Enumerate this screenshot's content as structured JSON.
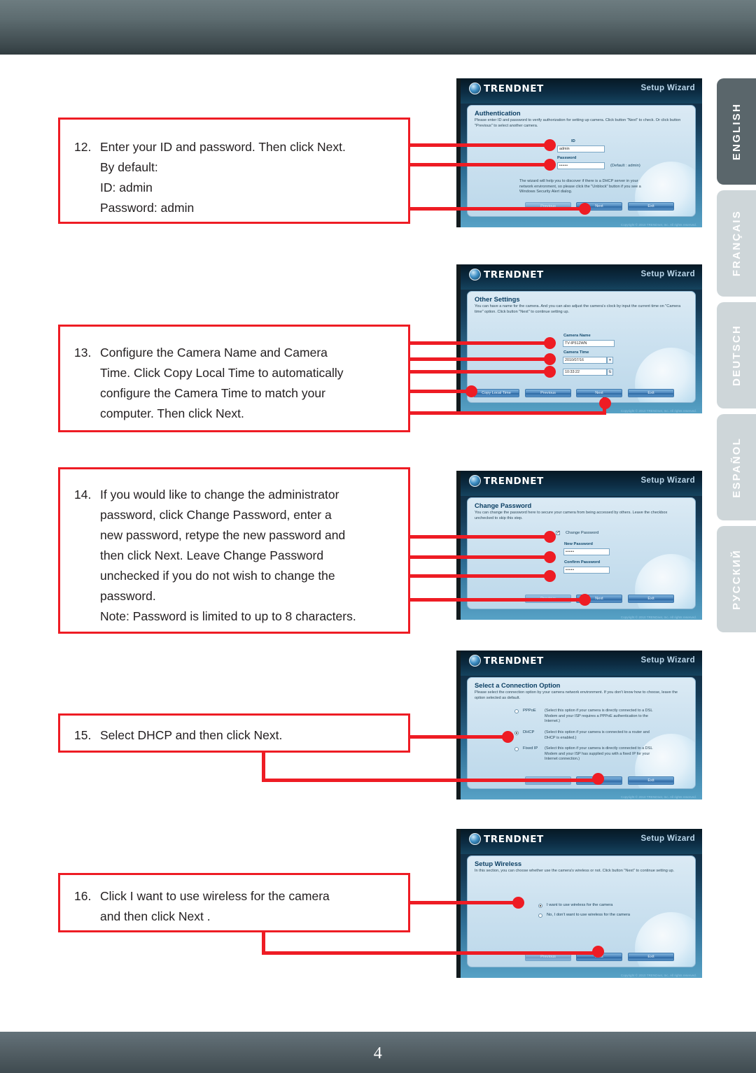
{
  "page": {
    "number": "4"
  },
  "languages": [
    {
      "label": "ENGLISH",
      "active": true
    },
    {
      "label": "FRANÇAIS",
      "active": false
    },
    {
      "label": "DEUTSCH",
      "active": false
    },
    {
      "label": "ESPAÑOL",
      "active": false
    },
    {
      "label": "РУССКИЙ",
      "active": false
    }
  ],
  "steps": [
    {
      "number": "12.",
      "lines": [
        "Enter your ID and password. Then click Next.",
        "By default:",
        "ID: admin",
        "Password: admin"
      ]
    },
    {
      "number": "13.",
      "lines": [
        "Configure the Camera Name and Camera",
        "Time. Click Copy Local Time to automatically",
        "configure the Camera Time to match your",
        "computer. Then click Next."
      ]
    },
    {
      "number": "14.",
      "lines": [
        "If you would like to change the administrator",
        "password, click Change Password, enter a",
        "new password, retype the new password and",
        "then click Next. Leave Change Password",
        "unchecked if you do not wish to change the",
        "password.",
        "Note: Password is limited to up to 8 characters."
      ]
    },
    {
      "number": "15.",
      "lines": [
        "Select DHCP and then click Next."
      ]
    },
    {
      "number": "16.",
      "lines": [
        "Click I want to use wireless for the camera",
        "and then click Next ."
      ]
    }
  ],
  "wizard": {
    "brand": "TRENDNET",
    "title": "Setup Wizard",
    "copyright": "Copyright © 2010 TRENDnet, Inc. All rights reserved.",
    "buttons": {
      "previous": "Previous",
      "next": "Next",
      "exit": "Exit",
      "copy_local_time": "Copy Local Time"
    },
    "screens": [
      {
        "id": "authentication",
        "title": "Authentication",
        "description": "Please enter ID and password to verify authorization for setting up camera. Click button \"Next\" to check. Or click button \"Previous\" to select another camera.",
        "id_label": "ID",
        "id_value": "admin",
        "password_label": "Password",
        "password_value": "•••••",
        "default_hint": "(Default : admin)",
        "note": "The wizard will help you to discover if there is a DHCP server in your network environment, so please click the \"Unblock\" button if you see a Windows Security Alert dialog."
      },
      {
        "id": "other-settings",
        "title": "Other Settings",
        "description": "You can have a name for the camera. And you can also adjust the camera's clock by input the current time on \"Camera time\" option. Click button \"Next\" to continue setting up.",
        "camera_name_label": "Camera Name",
        "camera_name_value": "TV-IP512WN",
        "camera_time_label": "Camera Time",
        "camera_date_value": "2010/07/16",
        "camera_clock_value": "10:33:22"
      },
      {
        "id": "change-password",
        "title": "Change Password",
        "description": "You can change the password here to secure your camera from being accessed by others. Leave the checkbox unchecked to skip this step.",
        "checkbox_label": "Change Password",
        "checkbox_checked": true,
        "new_password_label": "New Password",
        "new_password_value": "•••••",
        "confirm_password_label": "Confirm Password",
        "confirm_password_value": "•••••"
      },
      {
        "id": "connection-option",
        "title": "Select a Connection Option",
        "description": "Please select the connection option by your camera network environment. If you don't know how to choose, leave the option selected as default.",
        "options": [
          {
            "label": "PPPoE",
            "selected": false,
            "desc": "(Select this option if your camera is directly connected to a DSL Modem and your ISP requires a PPPoE authentication to the Internet.)"
          },
          {
            "label": "DHCP",
            "selected": true,
            "desc": "(Select this option if your camera is connected to a router and DHCP is enabled.)"
          },
          {
            "label": "Fixed IP",
            "selected": false,
            "desc": "(Select this option if your camera is directly connected to a DSL Modem and your ISP has supplied you with a fixed IP for your Internet connection.)"
          }
        ]
      },
      {
        "id": "setup-wireless",
        "title": "Setup Wireless",
        "description": "In this section, you can choose whether use the camera's wireless or not. Click button \"Next\" to continue setting up.",
        "options": [
          {
            "label": "I want to use wireless for the camera",
            "selected": true
          },
          {
            "label": "No, I don't want to use wireless for the camera",
            "selected": false
          }
        ]
      }
    ]
  },
  "colors": {
    "accent_red": "#EE1C24",
    "bar": "#5A666B"
  }
}
